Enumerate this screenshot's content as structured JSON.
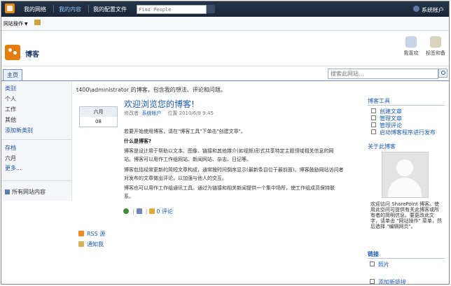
{
  "header": {
    "links": [
      "我的网络",
      "我的内容",
      "我的配置文件"
    ],
    "active_link": "我的内容",
    "search_placeholder": "Find People",
    "user_name": "系统帐户"
  },
  "actionbar": {
    "site_actions": "网站操作"
  },
  "site": {
    "title": "博客"
  },
  "title_buttons": {
    "like": "我喜欢",
    "tags": "标签和备"
  },
  "nav": {
    "home_tab": "主页",
    "search_placeholder": "搜索此网站..."
  },
  "leftnav": {
    "categories_heading": "类别",
    "categories": [
      "个人",
      "工作",
      "其他"
    ],
    "add_category": "添加新类别",
    "archive_heading": "存档",
    "archive_items": [
      "六月"
    ],
    "more": "更多...",
    "all_content": "所有网站内容"
  },
  "main": {
    "description": "t400\\administrator 的博客，包含我的想法、评论和问题。",
    "post": {
      "month": "六月",
      "day": "08",
      "title": "欢迎浏览您的博客!",
      "meta_modifier_label": "修改者",
      "meta_author": "系统帐户",
      "meta_time_label": "位置",
      "meta_time": "2010/6/8 9:45",
      "body": [
        "若要开始使用博客，请在\"博客工具\"下单击\"创建文章\"。",
        "什么是博客?",
        "博客是设计用于帮助以文本、图像、链接和其他媒介(如视频)形式共享特定主题领域相关信息的网",
        "站。博客可以用作工作组网站、新闻网站、杂志、日记等。",
        "博客包括经常更新的简短文章构成，通常按时间倒序显示(最新条目位于最前面)。博客鼓励网站访问者",
        "对发布的文章做出评论，以加强与他人的交互。",
        "博客也可以用作工作组通讯工具。通过为链接和相关新闻提供一个集中场所，使工作组成员保持联",
        "系。"
      ],
      "comments": "0 评论"
    },
    "rss": "RSS 源",
    "alert": "通知我"
  },
  "right": {
    "tools_heading": "博客工具",
    "tools": [
      "创建文章",
      "管理文章",
      "管理评论",
      "启动博客程序进行发布"
    ],
    "about_heading": "关于此博客",
    "about_text": "欢迎访问 SharePoint 博客。使用此空间可提供有关此博客或所有者的简明信息。要更改此文字，请单击 \"网站操作\" 菜单，然后选择 \"编辑网页\"。",
    "links_heading": "链接",
    "links": [
      "照片",
      "添加新链接"
    ]
  }
}
